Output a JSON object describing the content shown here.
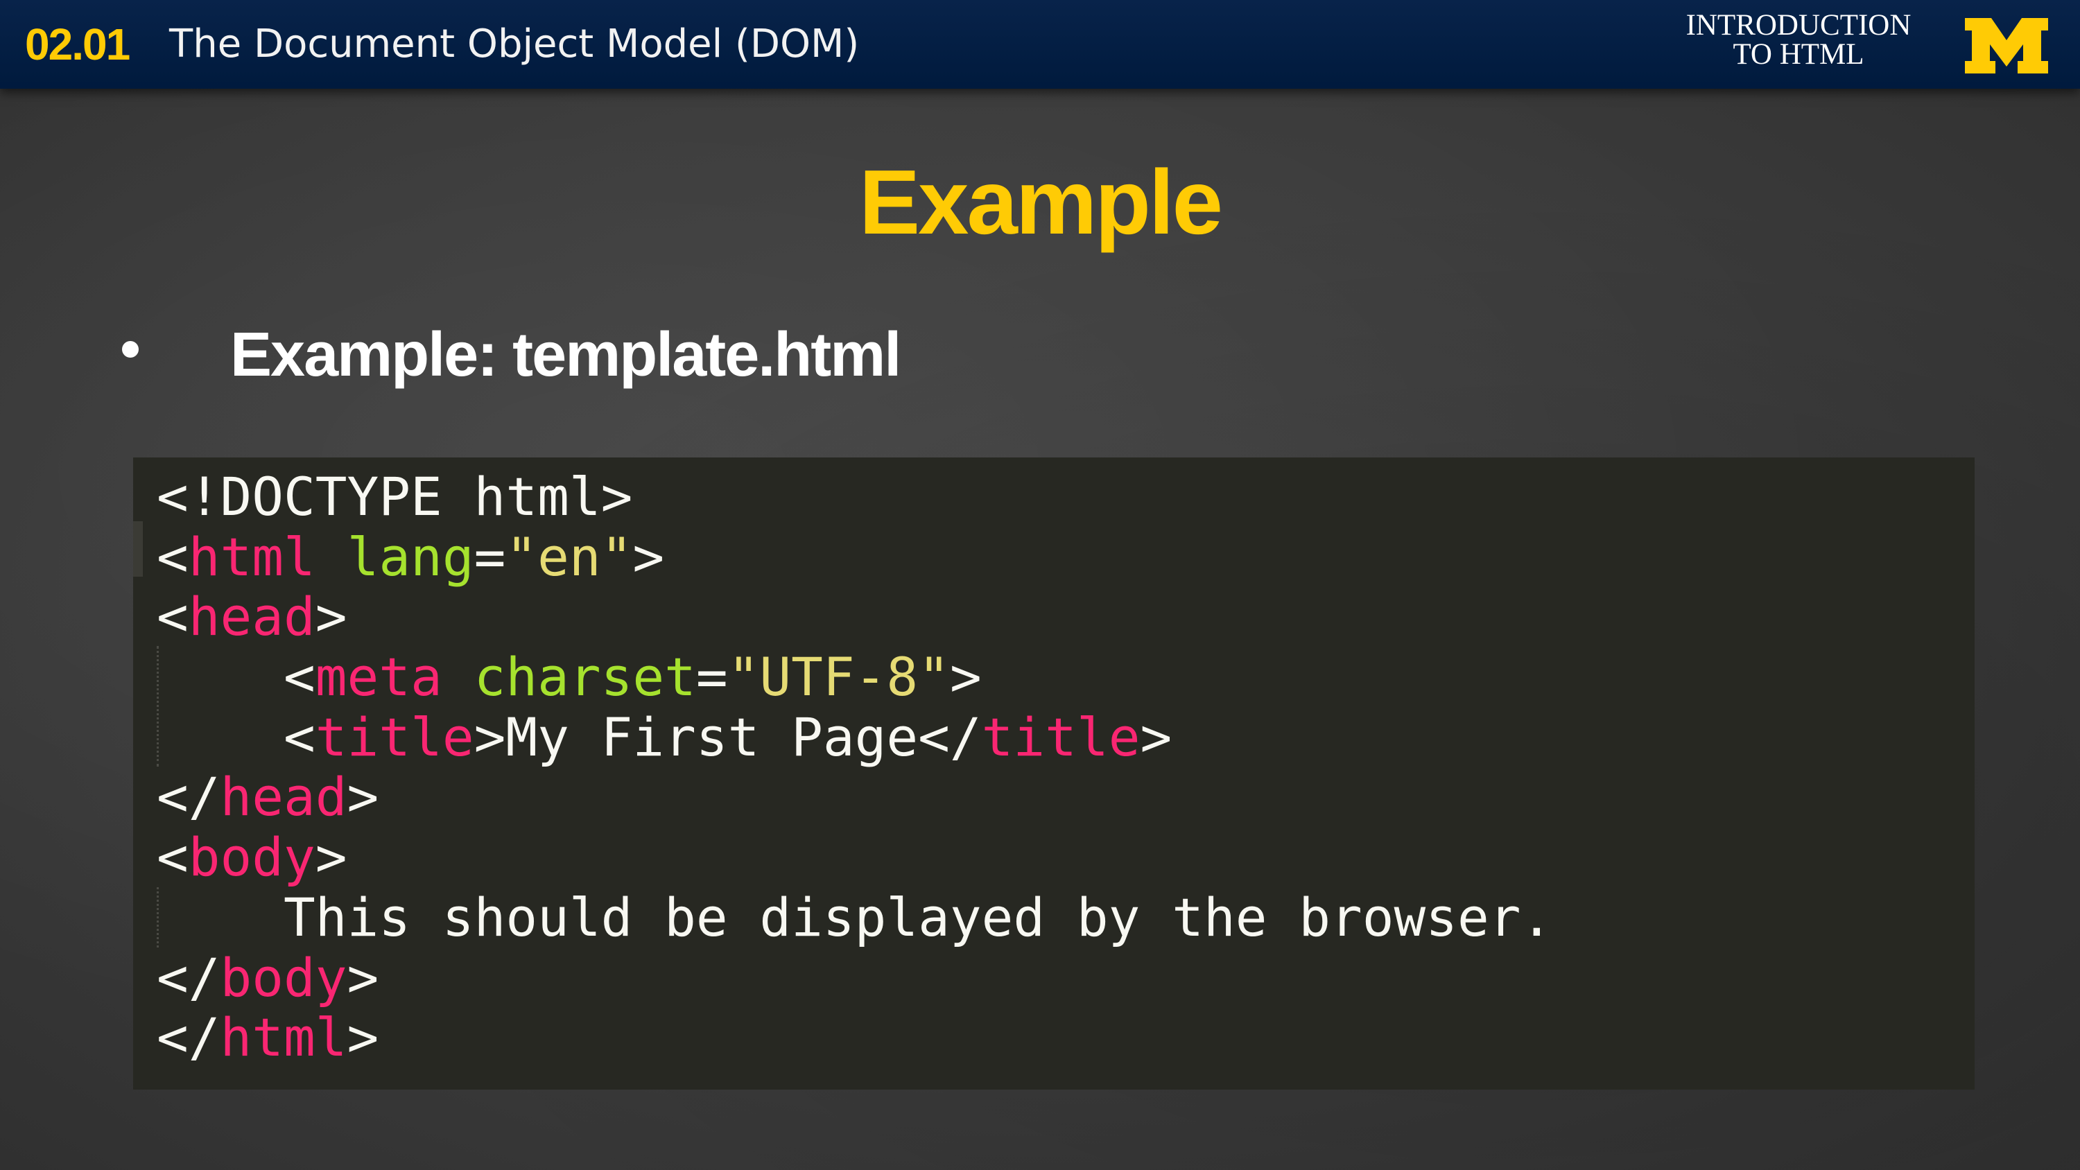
{
  "header": {
    "lesson_number": "02.01",
    "lesson_title": "The Document Object Model (DOM)",
    "course_line1": "INTRODUCTION",
    "course_line2": "TO HTML",
    "logo_icon": "university-block-m-logo",
    "logo_color": "#ffcb05",
    "background": "#001a3d"
  },
  "slide": {
    "title": "Example",
    "title_color": "#ffcb05",
    "bullet": "Example: template.html"
  },
  "code": {
    "theme": {
      "background": "#272822",
      "tag": "#f92672",
      "attribute": "#a6e22e",
      "string": "#e6db74",
      "text": "#f8f8f2"
    },
    "lines": [
      {
        "indent": "",
        "parts": [
          {
            "t": "plain",
            "v": "<!DOCTYPE html>"
          }
        ]
      },
      {
        "indent": "",
        "parts": [
          {
            "t": "plain",
            "v": "<"
          },
          {
            "t": "tag",
            "v": "html"
          },
          {
            "t": "plain",
            "v": " "
          },
          {
            "t": "attr",
            "v": "lang"
          },
          {
            "t": "plain",
            "v": "="
          },
          {
            "t": "str",
            "v": "\"en\""
          },
          {
            "t": "plain",
            "v": ">"
          }
        ]
      },
      {
        "indent": "",
        "parts": [
          {
            "t": "plain",
            "v": "<"
          },
          {
            "t": "tag",
            "v": "head"
          },
          {
            "t": "plain",
            "v": ">"
          }
        ]
      },
      {
        "indent": "    ",
        "parts": [
          {
            "t": "plain",
            "v": "<"
          },
          {
            "t": "tag",
            "v": "meta"
          },
          {
            "t": "plain",
            "v": " "
          },
          {
            "t": "attr",
            "v": "charset"
          },
          {
            "t": "plain",
            "v": "="
          },
          {
            "t": "str",
            "v": "\"UTF-8\""
          },
          {
            "t": "plain",
            "v": ">"
          }
        ]
      },
      {
        "indent": "    ",
        "parts": [
          {
            "t": "plain",
            "v": "<"
          },
          {
            "t": "tag",
            "v": "title"
          },
          {
            "t": "plain",
            "v": ">My First Page</"
          },
          {
            "t": "tag",
            "v": "title"
          },
          {
            "t": "plain",
            "v": ">"
          }
        ]
      },
      {
        "indent": "",
        "parts": [
          {
            "t": "plain",
            "v": "</"
          },
          {
            "t": "tag",
            "v": "head"
          },
          {
            "t": "plain",
            "v": ">"
          }
        ]
      },
      {
        "indent": "",
        "parts": [
          {
            "t": "plain",
            "v": "<"
          },
          {
            "t": "tag",
            "v": "body"
          },
          {
            "t": "plain",
            "v": ">"
          }
        ]
      },
      {
        "indent": "    ",
        "parts": [
          {
            "t": "plain",
            "v": "This should be displayed by the browser."
          }
        ]
      },
      {
        "indent": "",
        "parts": [
          {
            "t": "plain",
            "v": "</"
          },
          {
            "t": "tag",
            "v": "body"
          },
          {
            "t": "plain",
            "v": ">"
          }
        ]
      },
      {
        "indent": "",
        "parts": [
          {
            "t": "plain",
            "v": "</"
          },
          {
            "t": "tag",
            "v": "html"
          },
          {
            "t": "plain",
            "v": ">"
          }
        ]
      }
    ]
  }
}
